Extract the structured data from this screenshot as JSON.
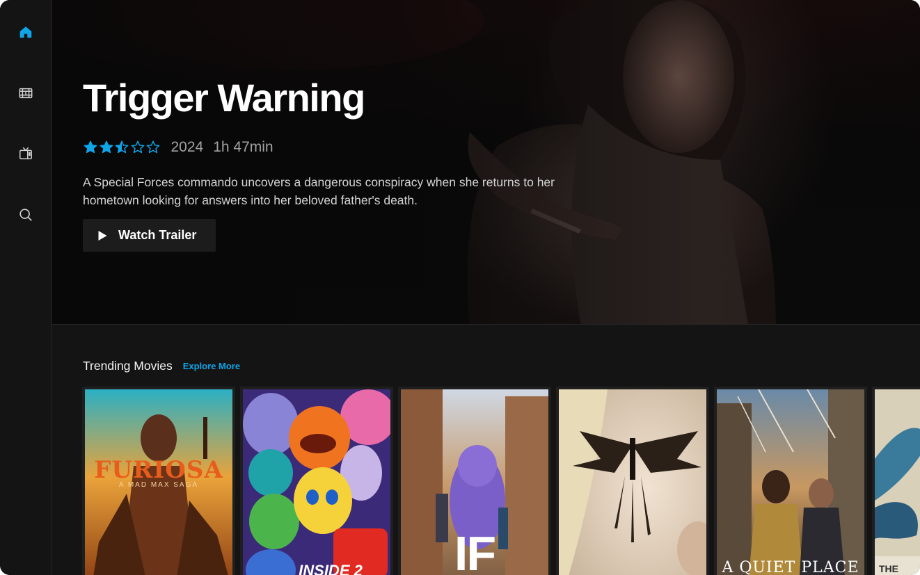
{
  "sidebar": {
    "items": [
      {
        "name": "home",
        "icon": "home-icon",
        "active": true
      },
      {
        "name": "movies",
        "icon": "film-icon",
        "active": false
      },
      {
        "name": "tv",
        "icon": "tv-icon",
        "active": false
      },
      {
        "name": "search",
        "icon": "search-icon",
        "active": false
      }
    ]
  },
  "hero": {
    "title": "Trigger Warning",
    "rating": 2.5,
    "rating_max": 5,
    "year": "2024",
    "duration": "1h 47min",
    "description": "A Special Forces commando uncovers a dangerous conspiracy when she returns to her hometown looking for answers into her beloved father's death.",
    "trailer_label": "Watch Trailer"
  },
  "trending": {
    "title": "Trending Movies",
    "explore_label": "Explore More",
    "movies": [
      {
        "poster_text": "FURIOSA",
        "poster_subtext": "A MAD MAX SAGA"
      },
      {
        "poster_text": "INSIDE 2"
      },
      {
        "poster_text": "IF"
      },
      {
        "poster_text": ""
      },
      {
        "poster_text": "A QUIET PLACE"
      },
      {
        "poster_text": "THE"
      }
    ]
  },
  "colors": {
    "accent": "#0ea5e9",
    "background": "#141414",
    "button_bg": "#1c1c1c",
    "meta_text": "#a3a3a3"
  }
}
